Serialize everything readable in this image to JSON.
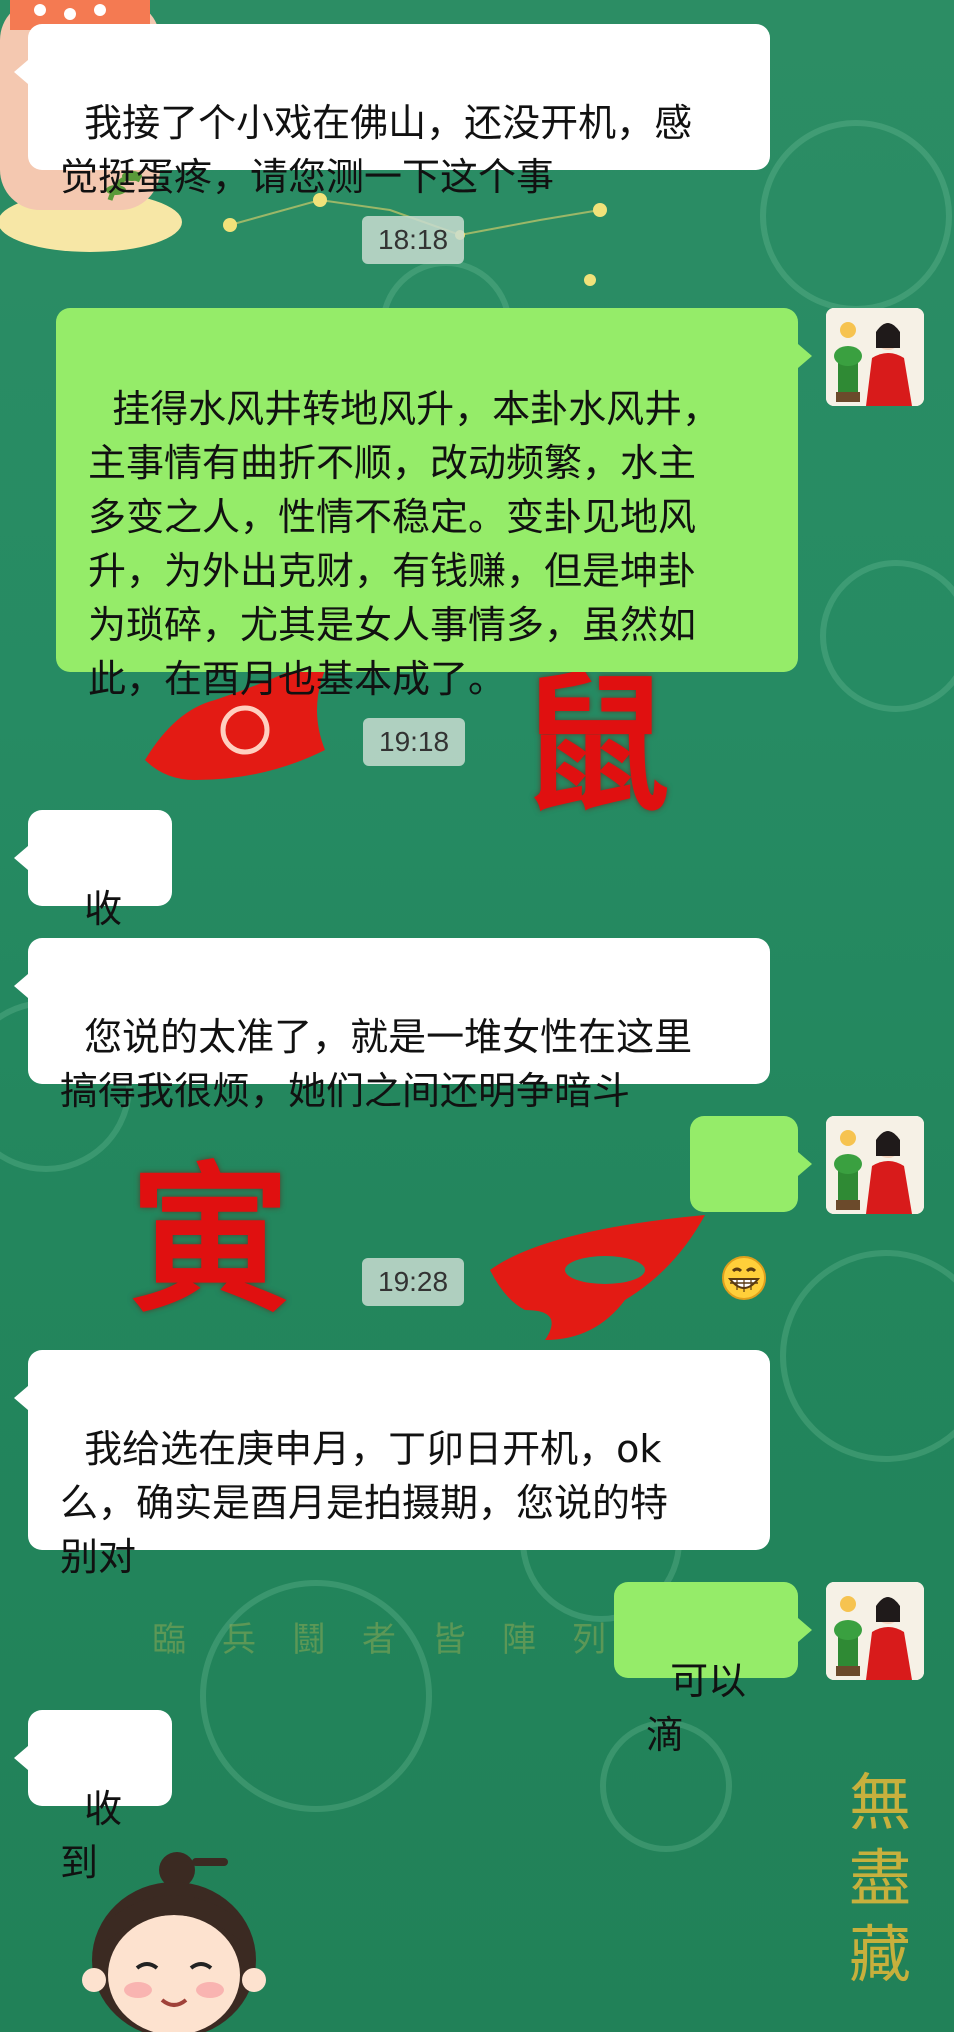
{
  "timestamps": [
    "18:18",
    "19:18",
    "19:28"
  ],
  "messages": [
    {
      "side": "incoming",
      "text": "我接了个小戏在佛山，还没开机，感\n觉挺蛋疼，请您测一下这个事"
    },
    {
      "side": "outgoing",
      "text": "挂得水风井转地风升，本卦水风井，\n主事情有曲折不顺，改动频繁，水主\n多变之人，性情不稳定。变卦见地风\n升，为外出克财，有钱赚，但是坤卦\n为琐碎，尤其是女人事情多，虽然如\n此，在酉月也基本成了。"
    },
    {
      "side": "incoming",
      "text": "收到"
    },
    {
      "side": "incoming",
      "text": "您说的太准了，就是一堆女性在这里\n搞得我很烦，她们之间还明争暗斗"
    },
    {
      "side": "outgoing",
      "emoji": "grin-emoji"
    },
    {
      "side": "incoming",
      "text": "我给选在庚申月，丁卯日开机，ok\n么，确实是酉月是拍摄期，您说的特\n别对"
    },
    {
      "side": "outgoing",
      "text": "可以滴"
    },
    {
      "side": "incoming",
      "text": "收到"
    }
  ],
  "background": {
    "faint_row": "臨兵鬪者皆陣列前",
    "vertical_text": "無盡藏",
    "red_glyph_1": "鼠",
    "red_glyph_2": "寅"
  },
  "colors": {
    "background": "#268b63",
    "outgoing_bubble": "#95ec69",
    "incoming_bubble": "#ffffff",
    "timestamp_bg": "#c8dcd0"
  }
}
